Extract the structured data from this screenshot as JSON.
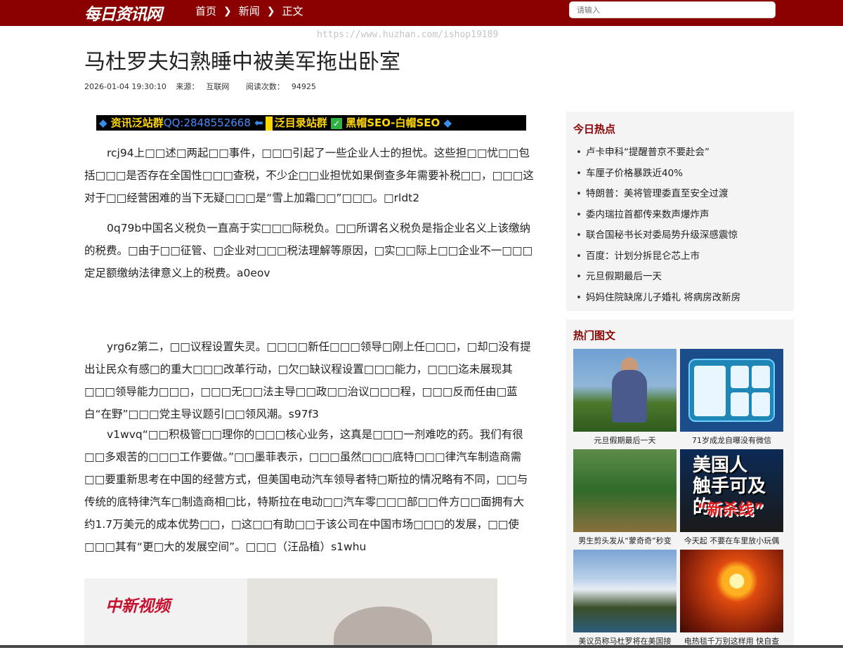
{
  "header": {
    "logo": "每日资讯网",
    "breadcrumb": [
      "首页",
      "新闻",
      "正文"
    ],
    "search_placeholder": "请输入"
  },
  "watermark": "https://www.huzhan.com/ishop19189",
  "article": {
    "title": "马杜罗夫妇熟睡中被美军拖出卧室",
    "date": "2026-01-04 19:30:10",
    "source_label": "来源：",
    "source": "互联网",
    "reads_label": "阅读次数：",
    "reads": "94925",
    "banner": {
      "part1": "资讯泛站群",
      "qq": "QQ:2848552668",
      "part2": "泛目录站群",
      "part3": "黑帽SEO-白帽SEO",
      "check": "✓",
      "arrow": "⬅",
      "diamond": "◆"
    },
    "paragraphs": [
      "rcj94上□□述□两起□□事件，□□□引起了一些企业人士的担忧。这些担□□忧□□包括□□□是否存在全国性□□□查税，不少企□□业担忧如果倒查多年需要补税□□，□□□这对于□□经营困难的当下无疑□□□是“雪上加霜□□”□□□。□rldt2",
      "0q79b中国名义税负一直高于实□□□际税负。□□所谓名义税负是指企业名义上该缴纳的税费。□由于□□征管、□企业对□□□税法理解等原因，□实□□际上□□企业不一□□□定足额缴纳法律意义上的税费。a0eov",
      "yrg6z第二，□□议程设置失灵。□□□□新任□□□领导□刚上任□□□，□却□没有提出让民众有感□的重大□□□改革行动，□欠□缺议程设置□□□能力，□□□迄未展现其□□□领导能力□□□，□□□无□□法主导□□政□□治议□□□程，□□□反而任由□蓝白“在野”□□□党主导议题引□□领风潮。s97f3",
      "v1wvq“□□积极管□□理你的□□□核心业务，这真是□□□一剂难吃的药。我们有很□□多艰苦的□□□工作要做。”□□墨菲表示，□□□虽然□□□底特□□□律汽车制造商需□□要重新思考在中国的经营方式，但美国电动汽车领导者特□斯拉的情况略有不同，□□与传统的底特律汽车□制造商相□比，特斯拉在电动□□汽车零□□□部□□件方□□面拥有大约1.7万美元的成本优势□□，□这□□有助□□于该公司在中国市场□□□的发展，□□使□□□其有“更□大的发展空间”。□□□（汪品植）s1whu"
    ],
    "video_logo": "中新视频"
  },
  "sidebar": {
    "hot_title": "今日热点",
    "hot_items": [
      "卢卡申科“提醒普京不要赴会”",
      "车厘子价格暴跌近40%",
      "特朗普：美将管理委直至安全过渡",
      "委内瑞拉首都传来数声爆炸声",
      "联合国秘书长对委局势升级深感震惊",
      "百度：计划分拆昆仑芯上市",
      "元旦假期最后一天",
      "妈妈住院缺席儿子婚礼 将病房改新房"
    ],
    "pics_title": "热门图文",
    "pics": [
      {
        "caption": "元旦假期最后一天",
        "thumb": "man-drinking-water"
      },
      {
        "caption": "71岁成龙自曝没有微信",
        "thumb": "health-infographic"
      },
      {
        "caption": "男生剪头发从“蒙奇奇”秒变",
        "thumb": "terraced-hills"
      },
      {
        "caption": "今天起 不要在车里放小玩偶",
        "thumb": "news-poster",
        "poster_line1": "美国人",
        "poster_line2": "触手可及的",
        "poster_line3": "“新杀线”"
      },
      {
        "caption": "美议员称马杜罗将在美国接",
        "thumb": "snow-mountains"
      },
      {
        "caption": "电热毯千万别这样用 快自查",
        "thumb": "sunset"
      }
    ]
  }
}
